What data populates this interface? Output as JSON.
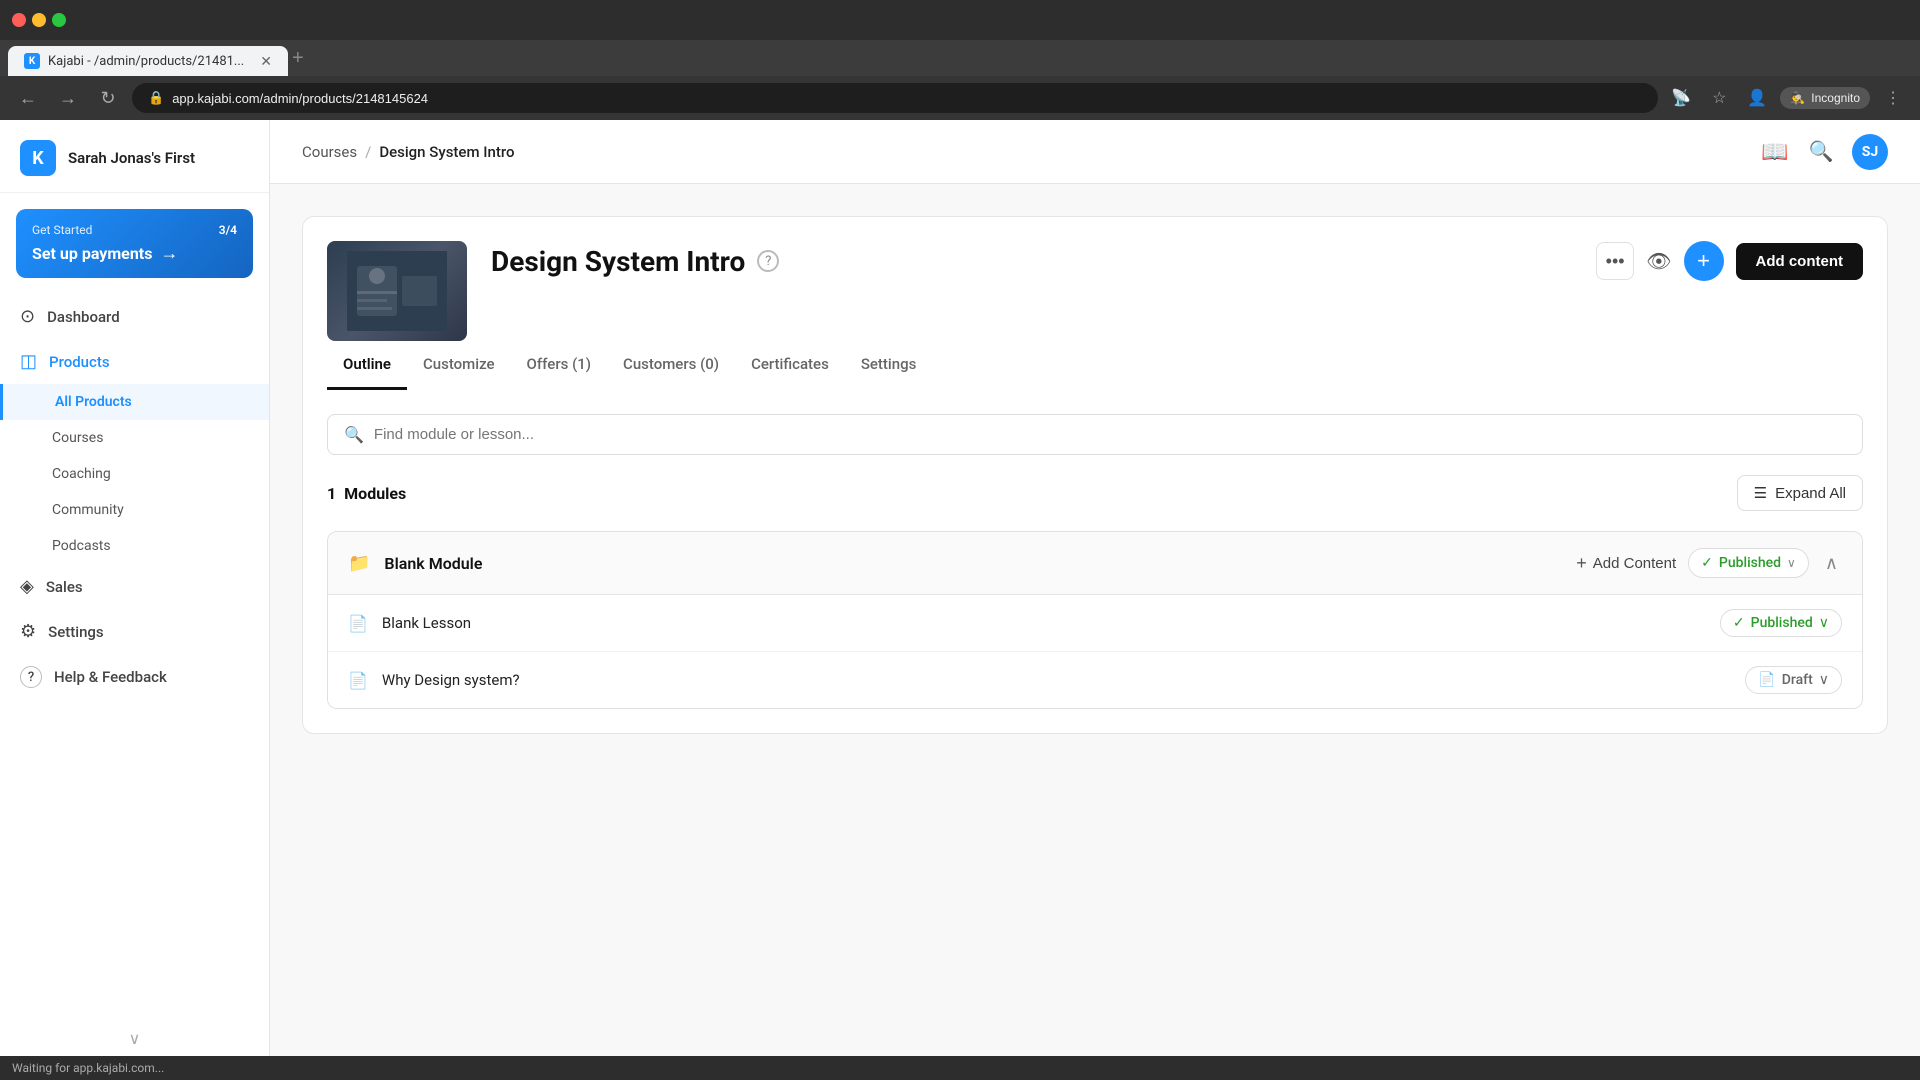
{
  "browser": {
    "tab_title": "Kajabi - /admin/products/21481...",
    "tab_favicon": "K",
    "url": "app.kajabi.com/admin/products/2148145624",
    "new_tab_label": "+",
    "nav_back": "←",
    "nav_forward": "→",
    "nav_refresh": "↻",
    "incognito_label": "Incognito"
  },
  "sidebar": {
    "brand": "Sarah Jonas's First",
    "logo_letter": "K",
    "get_started": {
      "label": "Get Started",
      "count": "3/4",
      "title": "Set up payments",
      "arrow": "→"
    },
    "nav_items": [
      {
        "id": "dashboard",
        "label": "Dashboard",
        "icon": "⊙"
      },
      {
        "id": "products",
        "label": "Products",
        "icon": "◫",
        "active": true
      }
    ],
    "sub_items": [
      {
        "id": "all-products",
        "label": "All Products",
        "active": true
      },
      {
        "id": "courses",
        "label": "Courses"
      },
      {
        "id": "coaching",
        "label": "Coaching"
      },
      {
        "id": "community",
        "label": "Community"
      },
      {
        "id": "podcasts",
        "label": "Podcasts"
      }
    ],
    "bottom_items": [
      {
        "id": "sales",
        "label": "Sales",
        "icon": "◈"
      },
      {
        "id": "settings",
        "label": "Settings",
        "icon": "⚙"
      },
      {
        "id": "help",
        "label": "Help & Feedback",
        "icon": "?"
      }
    ],
    "scroll_down": "∨"
  },
  "header": {
    "breadcrumb_courses": "Courses",
    "breadcrumb_sep": "/",
    "breadcrumb_current": "Design System Intro",
    "book_icon": "📖",
    "search_icon": "🔍",
    "avatar_initials": "SJ"
  },
  "course": {
    "title": "Design System Intro",
    "help_icon": "?",
    "tabs": [
      {
        "id": "outline",
        "label": "Outline",
        "active": true
      },
      {
        "id": "customize",
        "label": "Customize"
      },
      {
        "id": "offers",
        "label": "Offers (1)"
      },
      {
        "id": "customers",
        "label": "Customers (0)"
      },
      {
        "id": "certificates",
        "label": "Certificates"
      },
      {
        "id": "settings",
        "label": "Settings"
      }
    ],
    "search_placeholder": "Find module or lesson...",
    "modules_label": "Modules",
    "modules_count": "1",
    "expand_all": "Expand All",
    "expand_icon": "☰",
    "add_content_btn": "Add content",
    "more_icon": "•••",
    "view_icon": "👁",
    "plus_circle": "+",
    "modules": [
      {
        "id": "blank-module",
        "folder_icon": "📁",
        "title": "Blank Module",
        "add_content_label": "Add Content",
        "add_plus": "+",
        "status": "Published",
        "status_check": "✓",
        "status_chevron": "∨",
        "collapse_icon": "∧",
        "lessons": [
          {
            "id": "blank-lesson",
            "doc_icon": "📄",
            "title": "Blank Lesson",
            "status": "Published",
            "status_type": "published",
            "status_check": "✓",
            "status_chevron": "∨"
          },
          {
            "id": "why-design-system",
            "doc_icon": "📄",
            "title": "Why Design system?",
            "status": "Draft",
            "status_type": "draft",
            "status_icon": "📄",
            "status_chevron": "∨"
          }
        ]
      }
    ]
  },
  "status_bar": {
    "text": "Waiting for app.kajabi.com..."
  }
}
